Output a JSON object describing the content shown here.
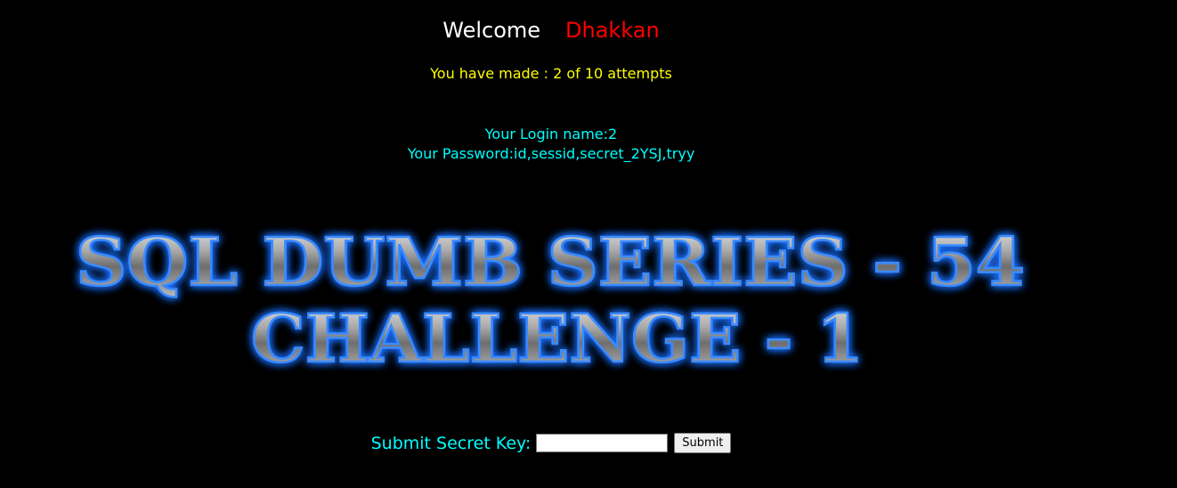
{
  "header": {
    "welcome_label": "Welcome",
    "user_name": "Dhakkan"
  },
  "attempts_text": "You have made : 2 of 10 attempts",
  "login": {
    "name_line": "Your Login name:2",
    "password_line": "Your Password:id,sessid,secret_2YSJ,tryy"
  },
  "banner": {
    "line1": "SQL DUMB SERIES - 54",
    "line2": "CHALLENGE - 1"
  },
  "form": {
    "label": "Submit Secret Key:",
    "input_value": "",
    "submit_label": "Submit"
  },
  "colors": {
    "background": "#000000",
    "welcome": "#ffffff",
    "user_name": "#ff0000",
    "attempts": "#ffff00",
    "info": "#00ffff",
    "banner_glow": "#1e6fff"
  }
}
